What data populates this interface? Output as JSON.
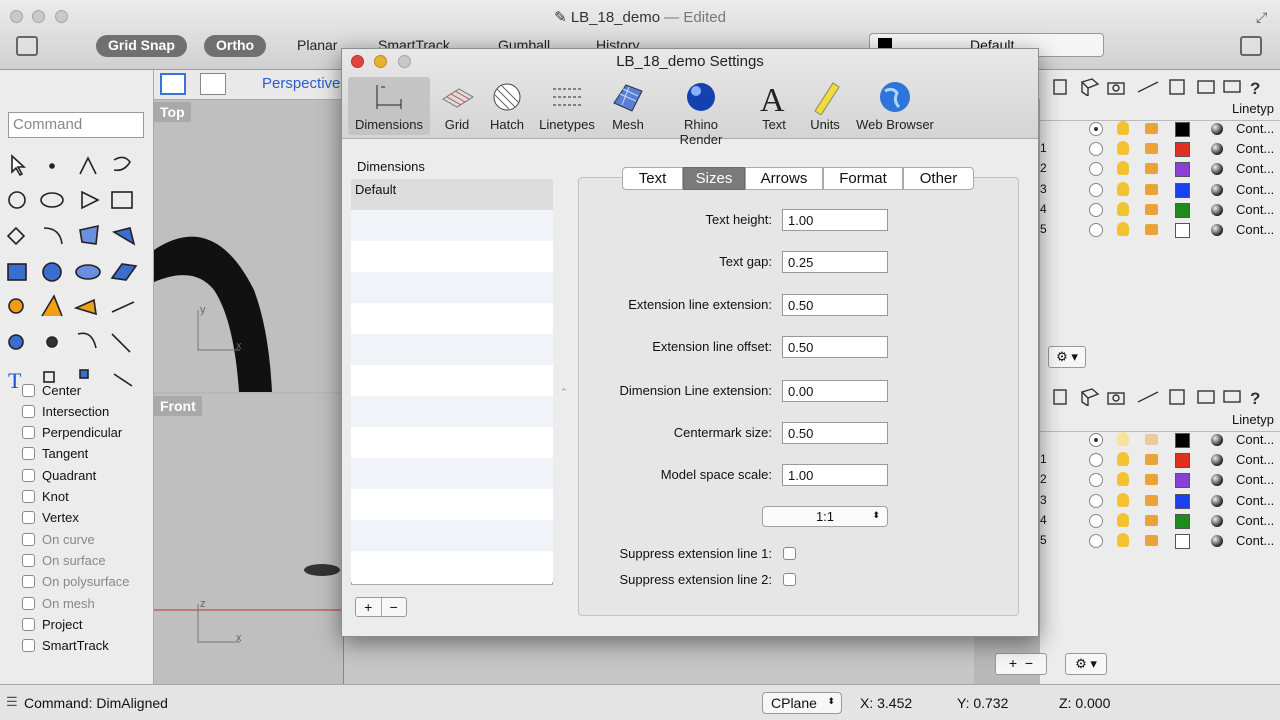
{
  "window": {
    "title": "LB_18_demo",
    "edited": "— Edited"
  },
  "toolbar": {
    "grid_snap": "Grid Snap",
    "ortho": "Ortho",
    "planar": "Planar",
    "smarttrack": "SmartTrack",
    "gumball": "Gumball",
    "history": "History",
    "layer_default": "Default"
  },
  "command": {
    "placeholder": "Command"
  },
  "viewports": {
    "perspective": "Perspective",
    "top": "Top",
    "front": "Front",
    "axis_y": "y",
    "axis_x": "x",
    "axis_z": "z"
  },
  "osnaps": [
    {
      "label": "Center",
      "enabled": true
    },
    {
      "label": "Intersection",
      "enabled": true
    },
    {
      "label": "Perpendicular",
      "enabled": true
    },
    {
      "label": "Tangent",
      "enabled": true
    },
    {
      "label": "Quadrant",
      "enabled": true
    },
    {
      "label": "Knot",
      "enabled": true
    },
    {
      "label": "Vertex",
      "enabled": true
    },
    {
      "label": "On curve",
      "enabled": false
    },
    {
      "label": "On surface",
      "enabled": false
    },
    {
      "label": "On polysurface",
      "enabled": false
    },
    {
      "label": "On mesh",
      "enabled": false
    },
    {
      "label": "Project",
      "enabled": true
    },
    {
      "label": "SmartTrack",
      "enabled": true
    }
  ],
  "layers": {
    "header": "Linetyp",
    "rows": [
      {
        "num": "",
        "color": "#000000",
        "linetype": "Cont..."
      },
      {
        "num": "1",
        "color": "#e03020",
        "linetype": "Cont..."
      },
      {
        "num": "2",
        "color": "#8a3fd6",
        "linetype": "Cont..."
      },
      {
        "num": "3",
        "color": "#1a40f0",
        "linetype": "Cont..."
      },
      {
        "num": "4",
        "color": "#1f8a1f",
        "linetype": "Cont..."
      },
      {
        "num": "5",
        "color": "#ffffff",
        "linetype": "Cont..."
      }
    ]
  },
  "dialog": {
    "title": "LB_18_demo Settings",
    "toolbar": [
      {
        "label": "Dimensions",
        "icon": "dimensions-icon"
      },
      {
        "label": "Grid",
        "icon": "grid-icon"
      },
      {
        "label": "Hatch",
        "icon": "hatch-icon"
      },
      {
        "label": "Linetypes",
        "icon": "linetypes-icon"
      },
      {
        "label": "Mesh",
        "icon": "mesh-icon"
      },
      {
        "label": "Rhino Render",
        "icon": "rhino-render-icon"
      },
      {
        "label": "Text",
        "icon": "text-icon"
      },
      {
        "label": "Units",
        "icon": "units-icon"
      },
      {
        "label": "Web Browser",
        "icon": "web-browser-icon"
      }
    ],
    "list_heading": "Dimensions",
    "list_items": [
      "Default"
    ],
    "tabs": [
      "Text",
      "Sizes",
      "Arrows",
      "Format",
      "Other"
    ],
    "selected_tab": "Sizes",
    "fields": [
      {
        "label": "Text height:",
        "value": "1.00"
      },
      {
        "label": "Text gap:",
        "value": "0.25"
      },
      {
        "label": "Extension line extension:",
        "value": "0.50"
      },
      {
        "label": "Extension line offset:",
        "value": "0.50"
      },
      {
        "label": "Dimension Line extension:",
        "value": "0.00"
      },
      {
        "label": "Centermark size:",
        "value": "0.50"
      },
      {
        "label": "Model space scale:",
        "value": "1.00"
      }
    ],
    "scale_select": "1:1",
    "checks": [
      {
        "label": "Suppress extension line 1:"
      },
      {
        "label": "Suppress extension line 2:"
      }
    ],
    "add": "+",
    "remove": "−"
  },
  "status": {
    "command": "Command: DimAligned",
    "cplane": "CPlane",
    "x": "X: 3.452",
    "y": "Y: 0.732",
    "z": "Z: 0.000"
  }
}
